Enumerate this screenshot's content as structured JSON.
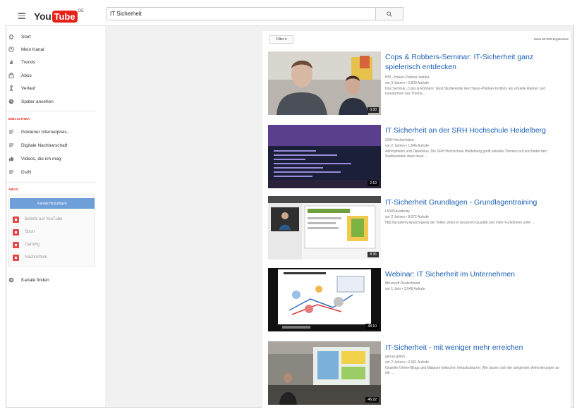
{
  "header": {
    "logo_you": "You",
    "logo_tube": "Tube",
    "logo_region": "DE",
    "search_value": "IT Sicherheit"
  },
  "sidebar": {
    "nav": [
      {
        "label": "Start",
        "icon": "home-icon"
      },
      {
        "label": "Mein Kanal",
        "icon": "user-circle-icon"
      },
      {
        "label": "Trends",
        "icon": "flame-icon"
      },
      {
        "label": "Abos",
        "icon": "subscriptions-icon"
      },
      {
        "label": "Verlauf",
        "icon": "hourglass-icon"
      },
      {
        "label": "Später ansehen",
        "icon": "clock-icon"
      }
    ],
    "library_title": "BIBLIOTHEK",
    "library": [
      {
        "label": "Goldener Internetpreis...",
        "icon": "playlist-icon"
      },
      {
        "label": "Digitale Nachbarschaft",
        "icon": "playlist-icon"
      },
      {
        "label": "Videos, die ich mag",
        "icon": "thumbs-up-icon"
      },
      {
        "label": "DsiN",
        "icon": "playlist-icon"
      }
    ],
    "abos_title": "ABOS",
    "abos_button": "Kanäle hinzufügen",
    "abos": [
      {
        "label": "Beliebt auf YouTube"
      },
      {
        "label": "Sport"
      },
      {
        "label": "Gaming"
      },
      {
        "label": "Nachrichten"
      }
    ],
    "find_channels": "Kanäle finden"
  },
  "results": {
    "filter_label": "Filter ▾",
    "count": "Etwa 60.000 Ergebnisse",
    "videos": [
      {
        "title": "Cops & Robbers-Seminar: IT-Sicherheit ganz spielerisch entdecken",
        "channel": "HPI - Hasso-Plattner-Institut",
        "meta": "vor 3 Jahren • 3.800 Aufrufe",
        "desc": "Das Seminar „Cops & Robbers“ lässt Studierende des Hasso-Plattner-Instituts als virtuelle Räuber und Gendarmen das Thema ...",
        "duration": "3:30"
      },
      {
        "title": "IT Sicherheit an der SRH Hochschule Heidelberg",
        "channel": "SRH Hochschulen",
        "meta": "vor 2 Jahren • 1.946 Aufrufe",
        "desc": "Abhörpfeilen und Datenklau. Die SRH Hochschule Heidelberg greift aktuelle Themen auf und bietet den Studierenden dazu neue ...",
        "duration": "2:19"
      },
      {
        "title": "IT-Sicherheit Grundlagen - Grundlagentraining",
        "channel": "LNWSacademy",
        "meta": "vor 2 Jahren • 8.672 Aufrufe",
        "desc": "http://academy.lwsacrogesis.de/ Volles Video in besseren Qualität und mehr Funktionen unter ...",
        "duration": "8:36"
      },
      {
        "title": "Webinar: IT Sicherheit im Unternehmen",
        "channel": "Microsoft Deutschland",
        "meta": "vor 1 Jahr • 3.948 Aufrufe",
        "desc": "",
        "duration": "48:10"
      },
      {
        "title": "IT-Sicherheit - mit weniger mehr erreichen",
        "channel": "genua gmbh",
        "meta": "vor 2 Jahren • 2.661 Aufrufe",
        "desc": "Gezielte Online-Blogs und Malware kritischen Infrastrukturen: Wie lassen sich die steigenden Anforderungen an die ...",
        "duration": "46:22"
      }
    ]
  }
}
